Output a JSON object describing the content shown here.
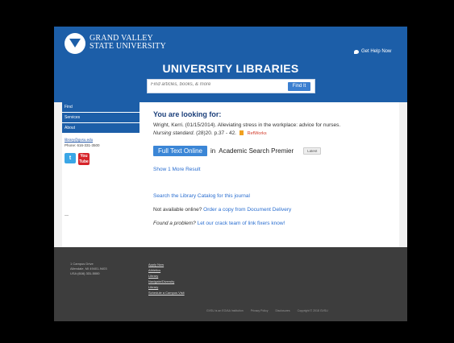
{
  "header": {
    "university_line1": "GRAND VALLEY",
    "university_line2": "STATE UNIVERSITY",
    "help_label": "Get Help Now",
    "title": "UNIVERSITY LIBRARIES",
    "search_placeholder": "Find articles, books, & more",
    "search_button": "Find It"
  },
  "sidebar": {
    "nav": [
      "Find",
      "Services",
      "About"
    ],
    "email": "library@gvsu.edu",
    "phone": "Phone: 616-331-3500",
    "twitter_label": "t",
    "youtube_label": "You Tube",
    "footer_mark": "—"
  },
  "main": {
    "heading": "You are looking for:",
    "citation_line": "Wright, Kerri. (01/15/2014). Alleviating stress in the workplace: advice for nurses.",
    "journal": "Nursing standard.",
    "details": "(28)20. p.37 - 42.",
    "refworks": "RefWorks",
    "full_text_button": "Full Text Online",
    "in_text": "in",
    "database": "Academic Search Premier",
    "latest_button": "Latest",
    "show_more": "Show 1 More Result",
    "catalog_link": "Search the Library Catalog for this journal",
    "not_available_text": "Not available online?",
    "order_link": "Order a copy from Document Delivery",
    "problem_text": "Found a problem?",
    "problem_link": "Let our crack team of link fixers know!"
  },
  "footer": {
    "addr_line1": "1 Campus Drive",
    "addr_line2": "Allendale, MI 49401-9403",
    "addr_line3": "USA",
    "phone": "(616) 331-5000",
    "links": [
      "Apply Now",
      "Athletics",
      "Library",
      "Navigate/Diversity",
      "Library",
      "Schedule a Campus Visit"
    ],
    "bottom": [
      "GVSU is an EO/AA Institution",
      "Privacy Policy",
      "Disclosures",
      "Copyright © 2018 GVSU"
    ]
  }
}
